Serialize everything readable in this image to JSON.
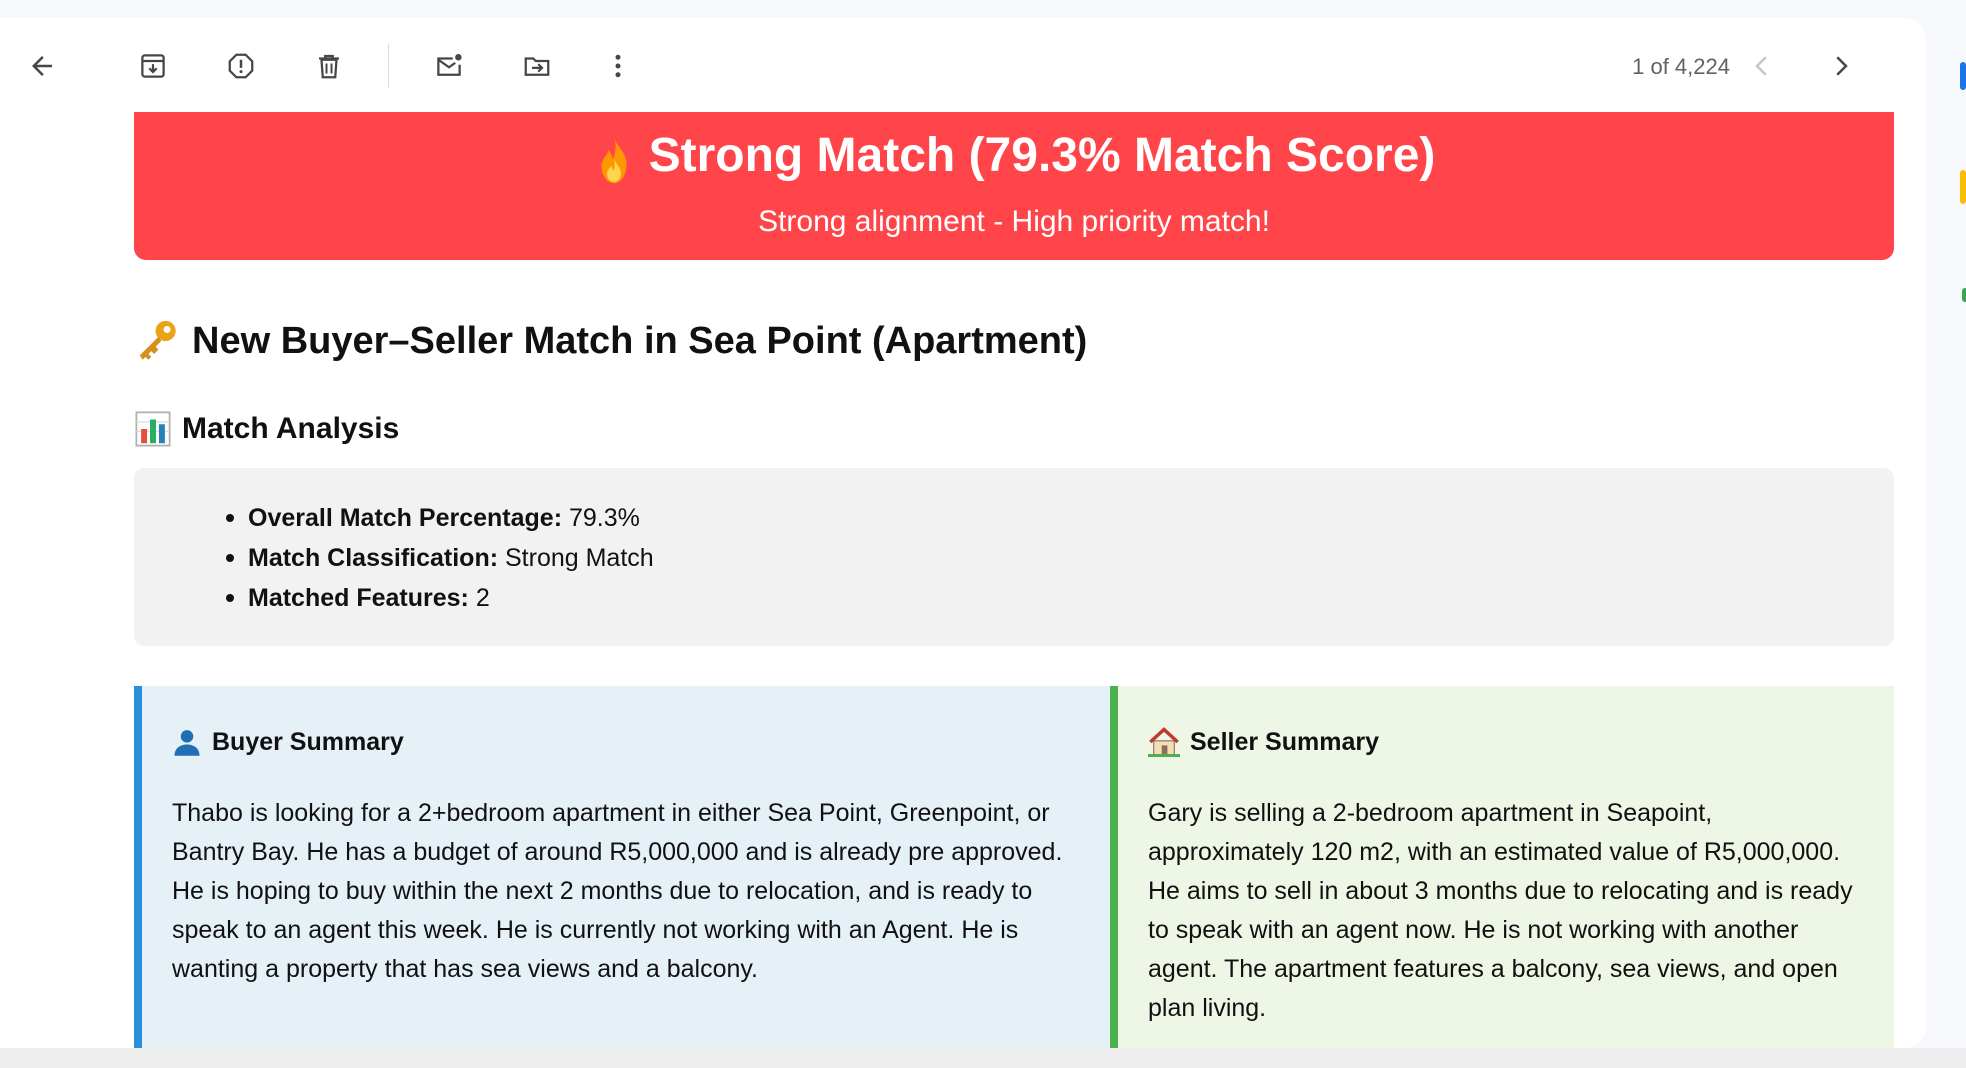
{
  "toolbar": {
    "back": "arrow-back-icon",
    "archive": "archive-icon",
    "report_spam": "report-spam-icon",
    "delete": "trash-icon",
    "mark_unread": "mark-unread-icon",
    "move_to": "move-to-folder-icon",
    "more": "more-vert-icon",
    "pager_text": "1 of 4,224",
    "prev": "chevron-left-icon",
    "next": "chevron-right-icon"
  },
  "banner": {
    "icon": "fire-icon",
    "title": "Strong Match (79.3% Match Score)",
    "subtitle": "Strong alignment - High priority match!",
    "color": "#ff4549"
  },
  "email": {
    "heading_icon": "key-icon",
    "heading": "New Buyer–Seller Match in Sea Point (Apartment)",
    "analysis_icon": "bar-chart-icon",
    "analysis_heading": "Match Analysis",
    "analysis_items": [
      {
        "label": "Overall Match Percentage:",
        "value": " 79.3%"
      },
      {
        "label": "Match Classification:",
        "value": " Strong Match"
      },
      {
        "label": "Matched Features:",
        "value": " 2"
      }
    ]
  },
  "buyer": {
    "icon": "person-icon",
    "title": "Buyer Summary",
    "text": "Thabo is looking for a 2+bedroom apartment in either Sea Point, Greenpoint, or Bantry Bay. He has a budget of around R5,000,000 and is already pre approved. He is hoping to buy within the next 2 months due to relocation, and is ready to speak to an agent this week. He is currently not working with an Agent. He is wanting a property that has sea views and a balcony.",
    "accent": "#2a8fd9"
  },
  "seller": {
    "icon": "house-icon",
    "title": "Seller Summary",
    "text": "Gary is selling a 2-bedroom apartment in Seapoint, approximately 120 m2, with an estimated value of R5,000,000. He aims to sell in about 3 months due to relocating and is ready to speak with an agent now. He is not working with another agent. The apartment features a balcony, sea views, and open plan living.",
    "accent": "#4caf50"
  }
}
